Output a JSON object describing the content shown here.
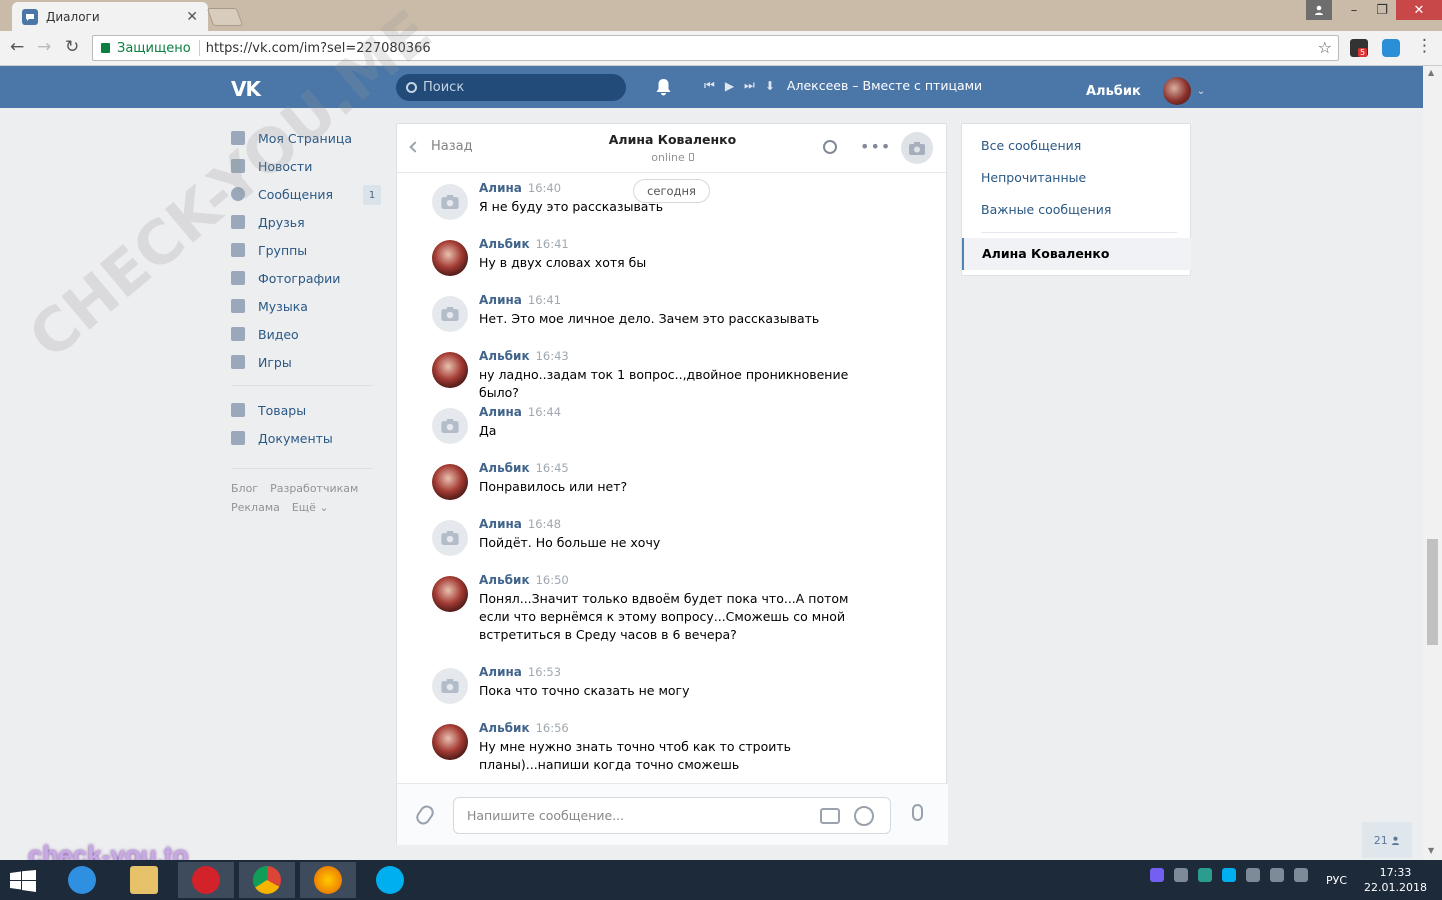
{
  "browser": {
    "tab_title": "Диалоги",
    "tab_close": "✕",
    "secure_label": "Защищено",
    "url": "https://vk.com/im?sel=227080366",
    "ext_badge": "5"
  },
  "header": {
    "logo": "VK",
    "search_placeholder": "Поиск",
    "track": "Алексеев – Вместе с птицами",
    "user_name": "Альбик"
  },
  "menu": {
    "items": [
      {
        "label": "Моя Страница"
      },
      {
        "label": "Новости"
      },
      {
        "label": "Сообщения",
        "badge": "1"
      },
      {
        "label": "Друзья"
      },
      {
        "label": "Группы"
      },
      {
        "label": "Фотографии"
      },
      {
        "label": "Музыка"
      },
      {
        "label": "Видео"
      },
      {
        "label": "Игры"
      }
    ],
    "items2": [
      {
        "label": "Товары"
      },
      {
        "label": "Документы"
      }
    ],
    "footer": [
      "Блог",
      "Разработчикам",
      "Реклама",
      "Ещё ⌄"
    ]
  },
  "dialog": {
    "back_label": "Назад",
    "title": "Алина Коваленко",
    "status": "online",
    "date_pill": "сегодня",
    "compose_placeholder": "Напишите сообщение...",
    "messages": [
      {
        "author": "Алина",
        "time": "16:40",
        "text": "Я не буду это рассказывать",
        "avatar": "cam"
      },
      {
        "author": "Альбик",
        "time": "16:41",
        "text": "Ну в двух словах хотя бы",
        "avatar": "photo"
      },
      {
        "author": "Алина",
        "time": "16:41",
        "text": "Нет. Это мое личное дело. Зачем это рассказывать",
        "avatar": "cam"
      },
      {
        "author": "Альбик",
        "time": "16:43",
        "text": "ну ладно..задам ток 1 вопрос..,двойное проникновение было?",
        "avatar": "photo"
      },
      {
        "author": "Алина",
        "time": "16:44",
        "text": "Да",
        "avatar": "cam"
      },
      {
        "author": "Альбик",
        "time": "16:45",
        "text": "Понравилось или нет?",
        "avatar": "photo"
      },
      {
        "author": "Алина",
        "time": "16:48",
        "text": "Пойдёт. Но больше не хочу",
        "avatar": "cam"
      },
      {
        "author": "Альбик",
        "time": "16:50",
        "text": "Понял...Значит только вдвоём будет пока что...А потом если что вернёмся к этому вопросу...Сможешь со мной встретиться в Среду часов в 6 вечера?",
        "avatar": "photo"
      },
      {
        "author": "Алина",
        "time": "16:53",
        "text": "Пока что точно сказать не могу",
        "avatar": "cam"
      },
      {
        "author": "Альбик",
        "time": "16:56",
        "text": "Ну мне нужно знать точно чтоб как то строить планы)...напиши когда точно сможешь",
        "avatar": "photo"
      }
    ]
  },
  "right_nav": {
    "all": "Все сообщения",
    "unread": "Непрочитанные",
    "important": "Важные сообщения",
    "selected": "Алина Коваленко"
  },
  "online_count": "21",
  "watermark": {
    "diag": "CHECK-YOU.ME",
    "site": "check-you.to"
  },
  "taskbar": {
    "lang": "РУС",
    "time": "17:33",
    "date": "22.01.2018"
  },
  "colors": {
    "vk_blue": "#4a76a8",
    "link": "#2a5885",
    "author": "#42648b"
  }
}
